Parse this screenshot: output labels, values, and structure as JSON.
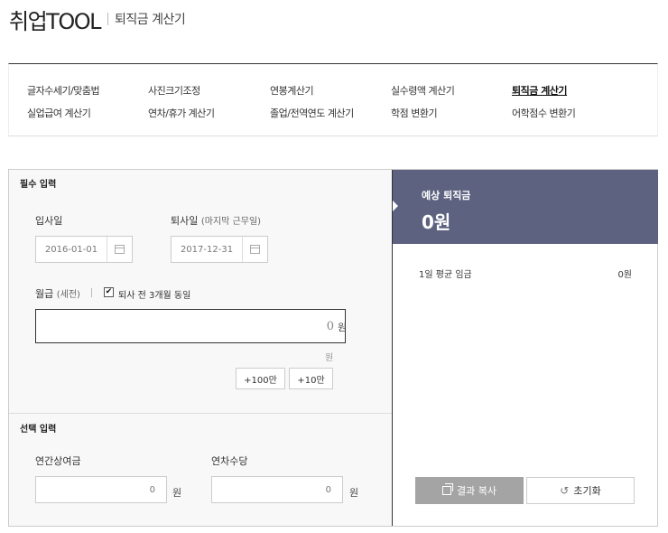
{
  "header": {
    "logo": "취업TOOL",
    "page_name": "퇴직금 계산기"
  },
  "nav": {
    "items": [
      {
        "label": "글자수세기/맞춤법",
        "active": false
      },
      {
        "label": "사진크기조정",
        "active": false
      },
      {
        "label": "연봉계산기",
        "active": false
      },
      {
        "label": "실수령액 계산기",
        "active": false
      },
      {
        "label": "퇴직금 계산기",
        "active": true
      },
      {
        "label": "실업급여 계산기",
        "active": false
      },
      {
        "label": "연차/휴가 계산기",
        "active": false
      },
      {
        "label": "졸업/전역연도 계산기",
        "active": false
      },
      {
        "label": "학점 변환기",
        "active": false
      },
      {
        "label": "어학점수 변환기",
        "active": false
      }
    ]
  },
  "form": {
    "required_title": "필수 입력",
    "hire_date_label": "입사일",
    "hire_date_value": "2016-01-01",
    "leave_date_label": "퇴사일",
    "leave_date_sub": "(마지막 근무일)",
    "leave_date_value": "2017-12-31",
    "salary_label": "월급",
    "salary_sub": "(세전)",
    "same_3months_label": "퇴사 전 3개월 동일",
    "same_3months_checked": true,
    "salary_value": "0",
    "won": "원",
    "inc_100": "+100만",
    "inc_10": "+10만",
    "optional_title": "선택 입력",
    "bonus_label": "연간상여금",
    "bonus_value": "0",
    "allowance_label": "연차수당",
    "allowance_value": "0"
  },
  "result": {
    "title": "예상 퇴직금",
    "value": "0원",
    "avg_label": "1일 평균 임금",
    "avg_value": "0원",
    "copy_button": "결과 복사",
    "reset_button": "초기화"
  },
  "colors": {
    "result_header_bg": "#5d6280",
    "copy_button_bg": "#a4a4a4"
  }
}
